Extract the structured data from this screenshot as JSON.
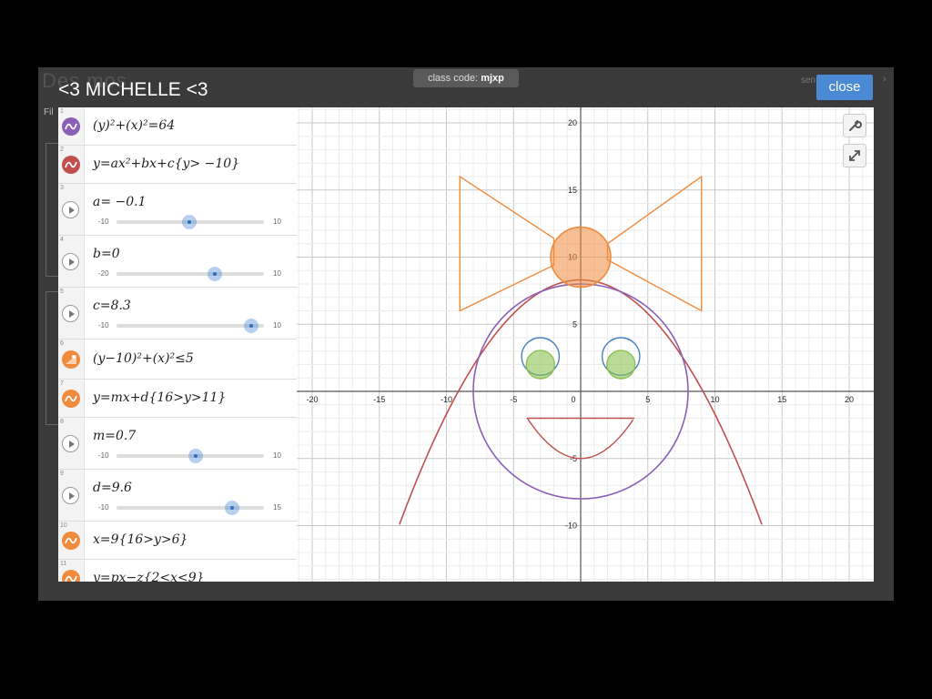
{
  "background": {
    "title": "Des   mos",
    "class_code_label": "class code:",
    "class_code": "mjxp",
    "send_label": "sen",
    "arrow": "›",
    "fil_label": "Fil"
  },
  "overlay": {
    "title": "<3 MICHELLE <3",
    "close_label": "close"
  },
  "colors": {
    "purple": "#8b5fb8",
    "red": "#c0504d",
    "orange": "#f08a3c",
    "green": "#8cc152",
    "blue": "#4a7fc1",
    "accent": "#4a8ad4"
  },
  "expressions": [
    {
      "num": "1",
      "kind": "graph",
      "icon": "purple-wave-icon",
      "color": "#8b5fb8",
      "math": "(y)²+(x)²=64"
    },
    {
      "num": "2",
      "kind": "graph",
      "icon": "red-wave-icon",
      "color": "#c0504d",
      "math": "y=ax²+bx+c{y> −10}"
    },
    {
      "num": "3",
      "kind": "slider",
      "icon": "play-icon",
      "math": "a= −0.1",
      "min": "-10",
      "max": "10",
      "value": -0.1,
      "lo": -10,
      "hi": 10
    },
    {
      "num": "4",
      "kind": "slider",
      "icon": "play-icon",
      "math": "b=0",
      "min": "-20",
      "max": "10",
      "value": 0,
      "lo": -20,
      "hi": 10
    },
    {
      "num": "5",
      "kind": "slider",
      "icon": "play-icon",
      "math": "c=8.3",
      "min": "-10",
      "max": "10",
      "value": 8.3,
      "lo": -10,
      "hi": 10
    },
    {
      "num": "6",
      "kind": "graph",
      "icon": "orange-region-icon",
      "color": "#f08a3c",
      "math": "(y−10)²+(x)²≤5"
    },
    {
      "num": "7",
      "kind": "graph",
      "icon": "orange-wave-icon",
      "color": "#f08a3c",
      "math": "y=mx+d{16>y>11}"
    },
    {
      "num": "8",
      "kind": "slider",
      "icon": "play-icon",
      "math": "m=0.7",
      "min": "-10",
      "max": "10",
      "value": 0.7,
      "lo": -10,
      "hi": 10
    },
    {
      "num": "9",
      "kind": "slider",
      "icon": "play-icon",
      "math": "d=9.6",
      "min": "-10",
      "max": "15",
      "value": 9.6,
      "lo": -10,
      "hi": 15
    },
    {
      "num": "10",
      "kind": "graph",
      "icon": "orange-wave-icon",
      "color": "#f08a3c",
      "math": "x=9{16>y>6}"
    },
    {
      "num": "11",
      "kind": "graph",
      "icon": "orange-wave-icon",
      "color": "#f08a3c",
      "math": "y=px−z{2<x<9}"
    }
  ],
  "graph": {
    "x_ticks": [
      "-20",
      "-15",
      "-10",
      "-5",
      "0",
      "5",
      "10",
      "15",
      "20"
    ],
    "y_ticks": [
      "20",
      "15",
      "10",
      "5",
      "-5",
      "-10"
    ],
    "xlim": [
      -20,
      20
    ],
    "ylim": [
      -14,
      20
    ],
    "grid": true,
    "tools": [
      "wrench-icon",
      "fullscreen-icon"
    ]
  }
}
